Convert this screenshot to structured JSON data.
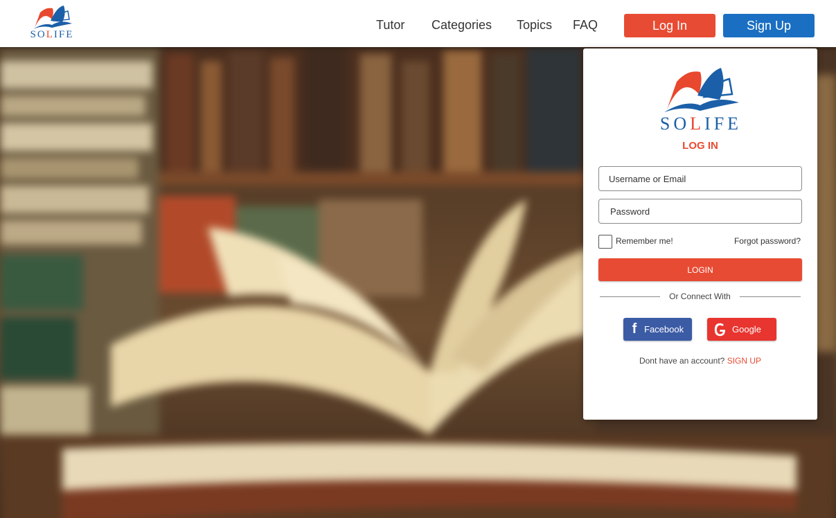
{
  "header": {
    "brand": {
      "text_main": "SO",
      "text_accent": "L",
      "text_end": "IFE"
    },
    "nav": [
      {
        "label": "Tutor"
      },
      {
        "label": "Categories"
      },
      {
        "label": "Topics"
      },
      {
        "label": "FAQ"
      }
    ],
    "login_label": "Log In",
    "signup_label": "Sign Up"
  },
  "login_card": {
    "brand": {
      "text_main": "SO",
      "text_accent": "L",
      "text_end": "IFE"
    },
    "title": "LOG IN",
    "username_placeholder": "Username or Email",
    "password_placeholder": "Password",
    "remember_label": "Remember me!",
    "remember_checked": false,
    "forgot_label": "Forgot password?",
    "submit_label": "LOGIN",
    "divider_text": "Or Connect With",
    "facebook_label": "Facebook",
    "google_label": "Google",
    "no_account_text": "Dont have an account? ",
    "signup_link": "SIGN UP"
  },
  "colors": {
    "primary_red": "#e84b33",
    "primary_blue": "#1a6fc2",
    "facebook_blue": "#3b5ba5",
    "google_red": "#e8352f"
  },
  "icons": [
    "solife-book-logo",
    "facebook-icon",
    "google-icon"
  ]
}
